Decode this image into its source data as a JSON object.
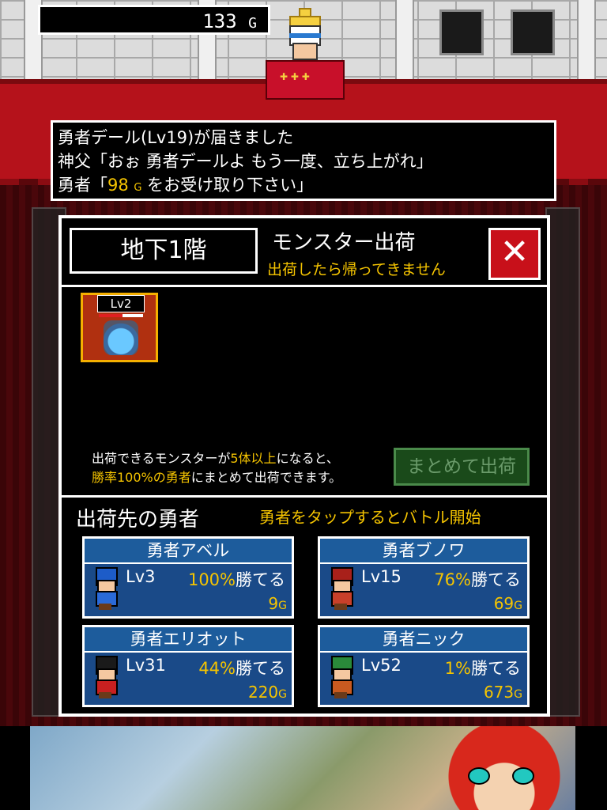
{
  "gold": {
    "amount": "133",
    "unit": "G"
  },
  "message": {
    "line1": "勇者デール(Lv19)が届きました",
    "line2": "神父「おぉ 勇者デールよ もう一度、立ち上がれ」",
    "line3_prefix": "勇者「",
    "line3_amount": "98",
    "line3_unit": "G",
    "line3_suffix": " をお受け取り下さい」"
  },
  "dialog": {
    "floor": "地下1階",
    "title": "モンスター出荷",
    "subtitle": "出荷したら帰ってきません",
    "close_label": "✕",
    "monster": {
      "level": "Lv2",
      "icon": "slime-in-jar-icon"
    },
    "info_line1_a": "出荷できるモンスターが",
    "info_line1_b": "5体以上",
    "info_line1_c": "になると、",
    "info_line2_a": "勝率100%の勇者",
    "info_line2_b": "にまとめて出荷できます。",
    "bulk_button": "まとめて出荷",
    "dest_title": "出荷先の勇者",
    "dest_hint": "勇者をタップするとバトル開始"
  },
  "heroes": [
    {
      "name": "勇者アベル",
      "level": "Lv3",
      "pct": "100%",
      "win": "勝てる",
      "gold": "9",
      "unit": "G",
      "hair": "#1d5cc8",
      "armor": "#2a6ad8",
      "icon": "hero-abel-icon"
    },
    {
      "name": "勇者ブノワ",
      "level": "Lv15",
      "pct": "76%",
      "win": "勝てる",
      "gold": "69",
      "unit": "G",
      "hair": "#a8201a",
      "armor": "#c8402a",
      "icon": "hero-benoit-icon"
    },
    {
      "name": "勇者エリオット",
      "level": "Lv31",
      "pct": "44%",
      "win": "勝てる",
      "gold": "220",
      "unit": "G",
      "hair": "#1a1a1a",
      "armor": "#c82020",
      "icon": "hero-elliot-icon"
    },
    {
      "name": "勇者ニック",
      "level": "Lv52",
      "pct": "1%",
      "win": "勝てる",
      "gold": "673",
      "unit": "G",
      "hair": "#2a8a3a",
      "armor": "#c85a20",
      "icon": "hero-nick-icon"
    }
  ]
}
